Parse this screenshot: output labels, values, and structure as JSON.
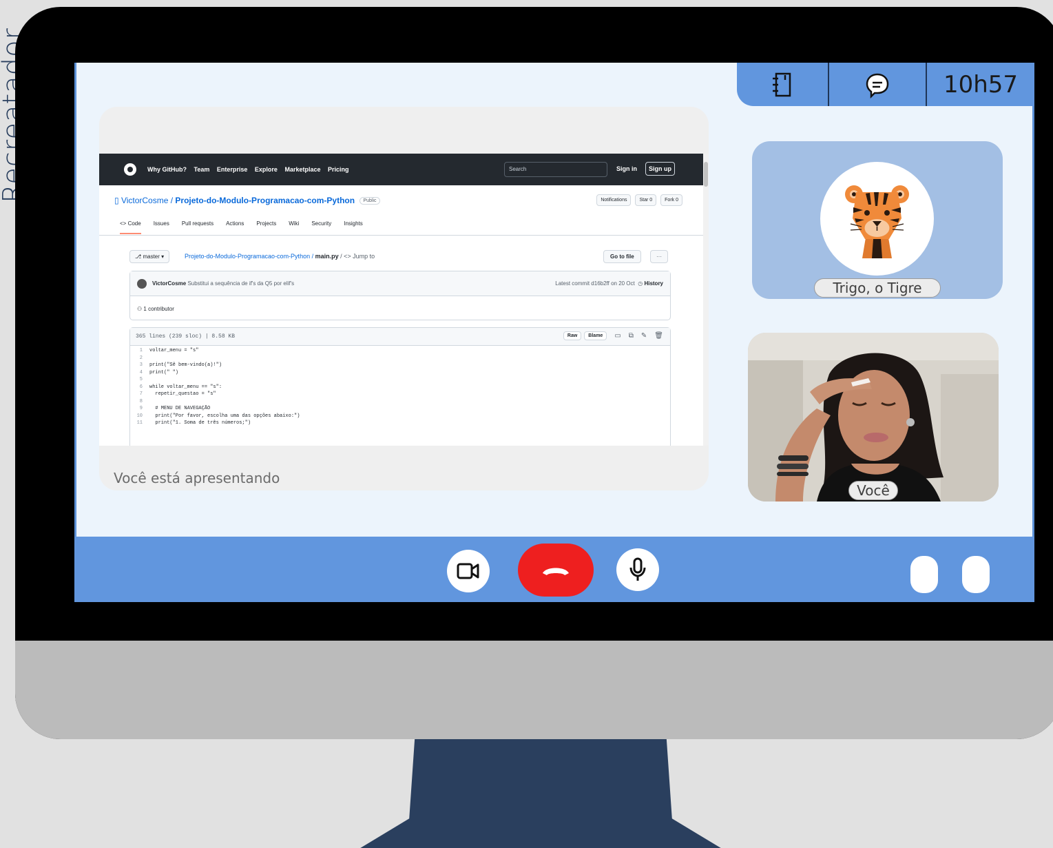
{
  "side_label": "Recreatador",
  "topbar": {
    "notebook_icon": "notebook-icon",
    "chat_icon": "chat-icon",
    "time": "10h57"
  },
  "share": {
    "status_label": "Você está apresentando",
    "github": {
      "nav": [
        "Why GitHub?",
        "Team",
        "Enterprise",
        "Explore",
        "Marketplace",
        "Pricing"
      ],
      "search_placeholder": "Search",
      "sign_in": "Sign in",
      "sign_up": "Sign up",
      "repo_owner": "VictorCosme",
      "repo_name": "Projeto-do-Modulo-Programacao-com-Python",
      "visibility": "Public",
      "actions": [
        "Notifications",
        "Star 0",
        "Fork 0"
      ],
      "tabs": [
        "<> Code",
        "Issues",
        "Pull requests",
        "Actions",
        "Projects",
        "Wiki",
        "Security",
        "Insights"
      ],
      "branch": "master",
      "path_repo": "Projeto-do-Modulo-Programacao-com-Python",
      "path_file": "main.py",
      "jump_to": "/ <> Jump to",
      "go_to_file": "Go to file",
      "more": "···",
      "commit_author": "VictorCosme",
      "commit_message": "Substitui a sequência de if's da Q5 por elif's",
      "commit_latest": "Latest commit d16b2ff on 20 Oct",
      "history": "History",
      "contributors": "1 contributor",
      "file_info": "365 lines (239 sloc)  |  8.58 KB",
      "raw": "Raw",
      "blame": "Blame",
      "code_lines": [
        {
          "n": "1",
          "t": "voltar_menu = \"s\""
        },
        {
          "n": "2",
          "t": ""
        },
        {
          "n": "3",
          "t": "print(\"Sê bem-vindo(a)!\")"
        },
        {
          "n": "4",
          "t": "print(\" \")"
        },
        {
          "n": "5",
          "t": ""
        },
        {
          "n": "6",
          "t": "while voltar_menu == \"s\":"
        },
        {
          "n": "7",
          "t": "  repetir_questao = \"s\""
        },
        {
          "n": "8",
          "t": ""
        },
        {
          "n": "9",
          "t": "  # MENU DE NAVEGAÇÃO"
        },
        {
          "n": "10",
          "t": "  print(\"Por favor, escolha uma das opções abaixo:\")"
        },
        {
          "n": "11",
          "t": "  print(\"1. Soma de três números;\")"
        }
      ]
    }
  },
  "participants": {
    "tiger_name": "Trigo, o Tigre",
    "self_name": "Você"
  },
  "controls": {
    "camera_icon": "camera-icon",
    "end_call_icon": "phone-hangup-icon",
    "mic_icon": "microphone-icon",
    "colors": {
      "bar": "#6196de",
      "end_call": "#ee1f1f"
    }
  }
}
